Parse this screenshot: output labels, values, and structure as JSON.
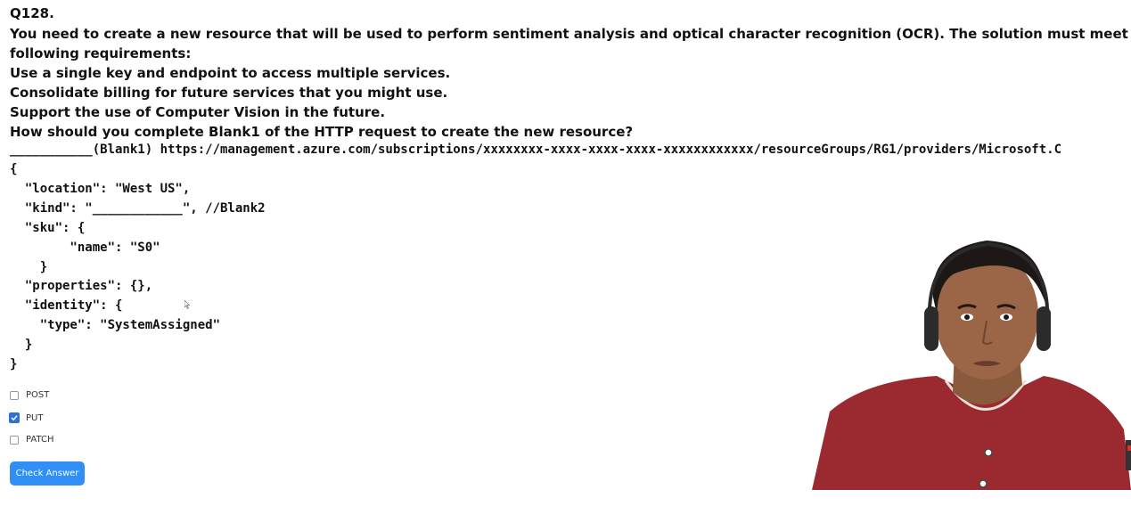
{
  "question": {
    "number": "Q128.",
    "lines": [
      "You need to create a new resource that will be used to perform sentiment analysis and optical character recognition (OCR). The solution must meet the",
      "following requirements:",
      "Use a single key and endpoint to access multiple services.",
      "Consolidate billing for future services that you might use.",
      "Support the use of Computer Vision in the future.",
      "How should you complete Blank1 of the HTTP request to create the new resource?"
    ]
  },
  "code": {
    "request_line": "___________(Blank1) https://management.azure.com/subscriptions/xxxxxxxx-xxxx-xxxx-xxxx-xxxxxxxxxxxx/resourceGroups/RG1/providers/Microsoft.C",
    "lines": [
      "{",
      "  \"location\": \"West US\",",
      "  \"kind\": \"____________\", //Blank2",
      "  \"sku\": {",
      "        \"name\": \"S0\"",
      "    }",
      "  \"properties\": {},",
      "  \"identity\": {",
      "    \"type\": \"SystemAssigned\"",
      "  }",
      "}"
    ]
  },
  "options": [
    {
      "label": "POST",
      "checked": false
    },
    {
      "label": "PUT",
      "checked": true
    },
    {
      "label": "PATCH",
      "checked": false
    }
  ],
  "check_button": "Check Answer",
  "colors": {
    "accent": "#2f8ff5",
    "checkbox_checked": "#2f6fd6",
    "shirt": "#9a2a2f"
  }
}
